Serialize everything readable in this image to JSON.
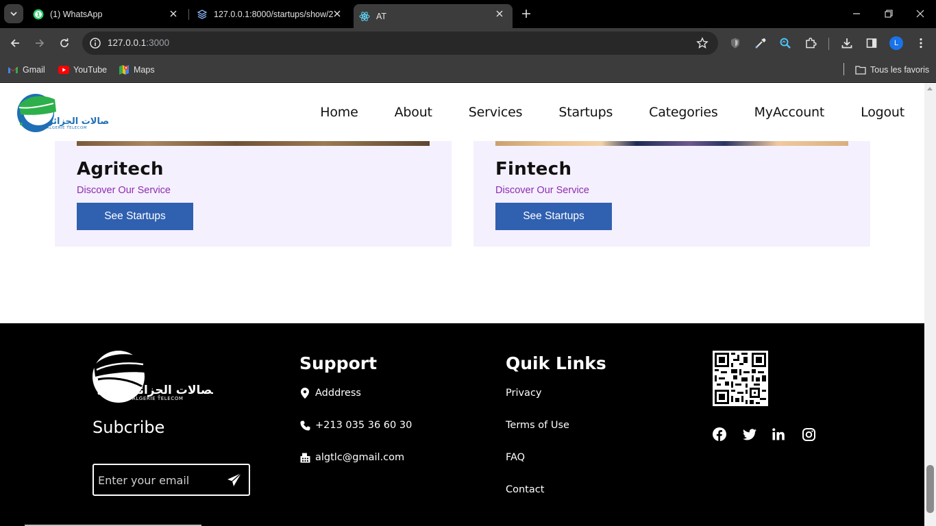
{
  "browser": {
    "tabs": [
      {
        "title": "(1) WhatsApp",
        "icon": "whatsapp-icon"
      },
      {
        "title": "127.0.0.1:8000/startups/show/2",
        "icon": "layers-icon"
      },
      {
        "title": "AT",
        "icon": "react-icon",
        "active": true
      }
    ],
    "url_host": "127.0.0.1",
    "url_port": ":3000",
    "bookmarks": [
      {
        "label": "Gmail",
        "icon": "gmail-icon"
      },
      {
        "label": "YouTube",
        "icon": "youtube-icon"
      },
      {
        "label": "Maps",
        "icon": "maps-icon"
      }
    ],
    "all_bookmarks_label": "Tous les favoris",
    "profile_initial": "L"
  },
  "site": {
    "nav": [
      "Home",
      "About",
      "Services",
      "Startups",
      "Categories",
      "MyAccount",
      "Logout"
    ],
    "cards": [
      {
        "title": "Agritech",
        "subtitle": "Discover Our Service",
        "button": "See Startups"
      },
      {
        "title": "Fintech",
        "subtitle": "Discover Our Service",
        "button": "See Startups"
      }
    ],
    "colors": {
      "card_bg": "#f5f0fd",
      "button": "#3060b0",
      "subtitle": "#8e2bb3",
      "logo_green": "#2db04b",
      "logo_blue": "#1f6fb5"
    }
  },
  "footer": {
    "subscribe_title": "Subcribe",
    "email_placeholder": "Enter your email",
    "support_title": "Support",
    "support_items": [
      {
        "text": "Adddress",
        "icon": "map-pin-icon"
      },
      {
        "text": "+213 035 36 60 30",
        "icon": "phone-icon"
      },
      {
        "text": "algtlc@gmail.com",
        "icon": "fax-icon"
      }
    ],
    "quicklinks_title": "Quik Links",
    "quicklinks": [
      "Privacy",
      "Terms of Use",
      "FAQ",
      "Contact"
    ],
    "social": [
      "facebook-icon",
      "twitter-icon",
      "linkedin-icon",
      "instagram-icon"
    ]
  }
}
